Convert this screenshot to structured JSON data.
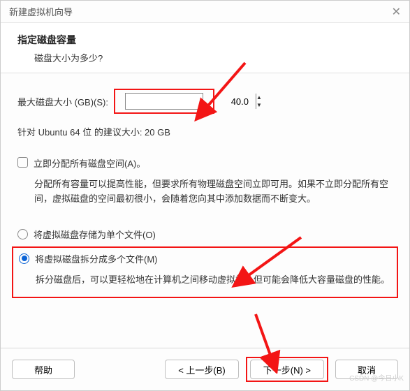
{
  "titlebar": {
    "title": "新建虚拟机向导"
  },
  "header": {
    "heading": "指定磁盘容量",
    "question": "磁盘大小为多少?"
  },
  "sizeRow": {
    "label": "最大磁盘大小 (GB)(S):",
    "value": "40.0"
  },
  "hint": "针对 Ubuntu 64 位 的建议大小: 20 GB",
  "alloc": {
    "label": "立即分配所有磁盘空间(A)。",
    "desc": "分配所有容量可以提高性能，但要求所有物理磁盘空间立即可用。如果不立即分配所有空间，虚拟磁盘的空间最初很小，会随着您向其中添加数据而不断变大。"
  },
  "radio1": {
    "label": "将虚拟磁盘存储为单个文件(O)"
  },
  "radio2": {
    "label": "将虚拟磁盘拆分成多个文件(M)",
    "desc": "拆分磁盘后，可以更轻松地在计算机之间移动虚拟机，但可能会降低大容量磁盘的性能。"
  },
  "footer": {
    "help": "帮助",
    "back": "< 上一步(B)",
    "next": "下一步(N) >",
    "cancel": "取消"
  },
  "watermark": "CSDN @今日小K"
}
